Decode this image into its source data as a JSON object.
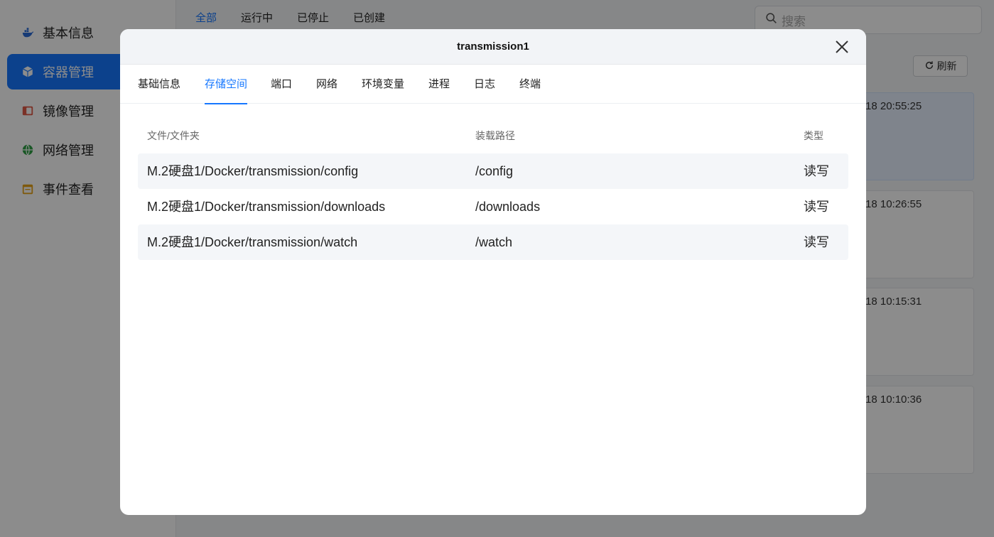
{
  "sidebar": {
    "items": [
      {
        "label": "基本信息",
        "icon": "docker-whale-icon",
        "active": false,
        "color": "#2b6cd8"
      },
      {
        "label": "容器管理",
        "icon": "cube-icon",
        "active": true,
        "color": "#ffffff"
      },
      {
        "label": "镜像管理",
        "icon": "image-layers-icon",
        "active": false,
        "color": "#e05a47"
      },
      {
        "label": "网络管理",
        "icon": "globe-icon",
        "active": false,
        "color": "#2f9e44"
      },
      {
        "label": "事件查看",
        "icon": "event-calendar-icon",
        "active": false,
        "color": "#e8a317"
      }
    ]
  },
  "filters": {
    "tabs": [
      {
        "label": "全部",
        "active": true
      },
      {
        "label": "运行中",
        "active": false
      },
      {
        "label": "已停止",
        "active": false
      },
      {
        "label": "已创建",
        "active": false
      }
    ]
  },
  "search": {
    "placeholder": "搜索"
  },
  "toolbar": {
    "refresh_label": "刷新"
  },
  "containers": [
    {
      "time": "18 20:55:25",
      "selected": true
    },
    {
      "time": "18 10:26:55",
      "selected": false
    },
    {
      "time": "18 10:15:31",
      "selected": false
    },
    {
      "time": "18 10:10:36",
      "selected": false
    }
  ],
  "modal": {
    "title": "transmission1",
    "tabs": [
      {
        "label": "基础信息",
        "active": false
      },
      {
        "label": "存储空间",
        "active": true
      },
      {
        "label": "端口",
        "active": false
      },
      {
        "label": "网络",
        "active": false
      },
      {
        "label": "环境变量",
        "active": false
      },
      {
        "label": "进程",
        "active": false
      },
      {
        "label": "日志",
        "active": false
      },
      {
        "label": "终端",
        "active": false
      }
    ],
    "table": {
      "headers": [
        "文件/文件夹",
        "装载路径",
        "类型"
      ],
      "rows": [
        [
          "M.2硬盘1/Docker/transmission/config",
          "/config",
          "读写"
        ],
        [
          "M.2硬盘1/Docker/transmission/downloads",
          "/downloads",
          "读写"
        ],
        [
          "M.2硬盘1/Docker/transmission/watch",
          "/watch",
          "读写"
        ]
      ]
    }
  },
  "colors": {
    "accent": "#1677ff",
    "overlay": "rgba(0,0,0,0.45)"
  }
}
